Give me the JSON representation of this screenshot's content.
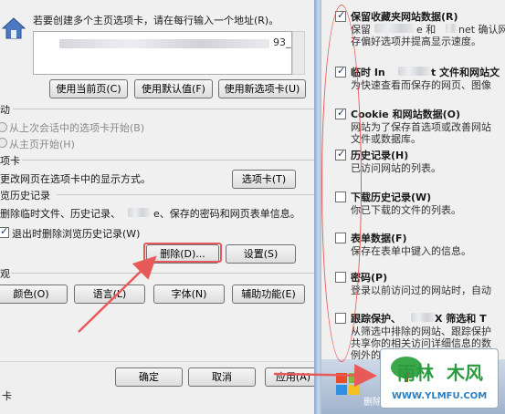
{
  "home": {
    "instruction": "若要创建多个主页选项卡，请在每行输入一个地址(R)。",
    "url_suffix": "93_",
    "btn_current": "使用当前页(C)",
    "btn_default": "使用默认值(F)",
    "btn_newtab": "使用新选项卡(U)"
  },
  "startup": {
    "header": "动",
    "opt_last": "从上次会话中的选项卡开始(B)",
    "opt_home": "从主页开始(H)"
  },
  "tabs": {
    "header": "项卡",
    "desc": "更改网页在选项卡中的显示方式。",
    "btn": "选项卡(T)"
  },
  "history": {
    "header": "览历史记录",
    "desc_a": "删除临时文件、历史记录、",
    "desc_b": "e、保存的密码和网页表单信息。",
    "checkbox_label": "退出时删除浏览历史记录(W)",
    "btn_delete": "删除(D)...",
    "btn_settings": "设置(S)"
  },
  "appearance": {
    "header": "观",
    "btn_colors": "颜色(O)",
    "btn_language": "语言(L)",
    "btn_fonts": "字体(N)",
    "btn_access": "辅助功能(E)"
  },
  "footer": {
    "btn_ok": "确定",
    "btn_cancel": "取消",
    "btn_apply": "应用(A)",
    "left_text": "卡"
  },
  "delete_dialog": {
    "items": [
      {
        "title": "保留收藏夹网站数据(R)",
        "desc1": "保留",
        "desc2": "e 和",
        "desc3": "net 确认网站",
        "desc4": "存偏好选项并提高显示速度。",
        "checked": true
      },
      {
        "title_a": "临时 In",
        "title_b": "t 文件和网站文",
        "desc1": "为快速查看而保存的网页、图像",
        "checked": true
      },
      {
        "title": "Cookie 和网站数据(O)",
        "desc1": "网站为了保存首选项或改善网站",
        "desc2": "文件或数据库。",
        "checked": true
      },
      {
        "title": "历史记录(H)",
        "desc1": "已访问网站的列表。",
        "checked": true
      },
      {
        "title": "下载历史记录(W)",
        "desc1": "你已下载的文件的列表。",
        "checked": false
      },
      {
        "title": "表单数据(F)",
        "desc1": "保存在表单中键入的信息。",
        "checked": false
      },
      {
        "title": "密码(P)",
        "desc1": "登录以前访问过的网站时，自动",
        "checked": false
      },
      {
        "title_a": "跟踪保护、",
        "title_b": "X 筛选和 T",
        "desc1": "从筛选中排除的网站、跟踪保护",
        "desc2": "共享你的相关访问详细信息的数",
        "desc3": "例外的列表。",
        "checked": false
      }
    ]
  },
  "watermark": {
    "brand": "雨林",
    "brand_b": "木风",
    "site": "WWW.YLMFU.COM",
    "taskbar_text": "删除"
  },
  "colors": {
    "accent_red": "#e85a5a",
    "brand_green": "#2a9b3e"
  }
}
